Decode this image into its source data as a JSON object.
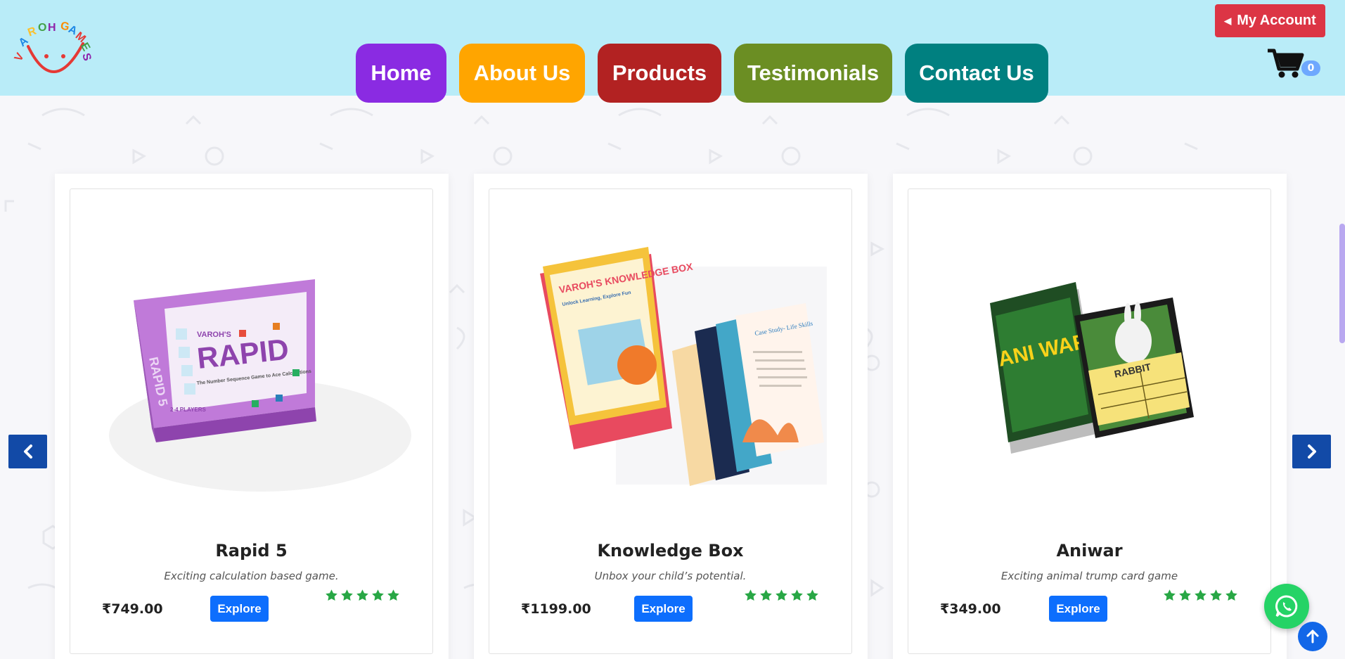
{
  "brand": {
    "logo_text": "VAROH GAMES"
  },
  "nav": [
    {
      "label": "Home",
      "color": "#8a2be2"
    },
    {
      "label": "About Us",
      "color": "#ffa500"
    },
    {
      "label": "Products",
      "color": "#b22222"
    },
    {
      "label": "Testimonials",
      "color": "#6b8e23"
    },
    {
      "label": "Contact Us",
      "color": "#008080"
    }
  ],
  "account": {
    "label": "My Account"
  },
  "cart": {
    "count": "0"
  },
  "products": [
    {
      "name": "Rapid 5",
      "description": "Exciting calculation based game.",
      "price": "₹749.00",
      "button": "Explore",
      "rating": 5
    },
    {
      "name": "Knowledge Box",
      "description": "Unbox your child’s potential.",
      "price": "₹1199.00",
      "button": "Explore",
      "rating": 5
    },
    {
      "name": "Aniwar",
      "description": "Exciting animal trump card game",
      "price": "₹349.00",
      "button": "Explore",
      "rating": 5
    }
  ],
  "product_art": {
    "rapid": {
      "box_title": "RAPID",
      "side_label": "RAPID 5",
      "tagline": "The Number Sequence Game to Ace Calculations",
      "players": "2-4 PLAYERS",
      "brand": "VAROH'S"
    },
    "knowledge": {
      "box_title": "VAROH'S KNOWLEDGE BOX",
      "subtitle": "Unlock Learning, Explore Fun",
      "card_title": "Case Study- Life Skills"
    },
    "aniwar": {
      "title": "ANI WAR",
      "card_title": "RABBIT"
    }
  },
  "colors": {
    "header_bg": "#b9ecf8",
    "accent": "#0d6efd",
    "star": "#28a745",
    "account": "#dc3545"
  }
}
